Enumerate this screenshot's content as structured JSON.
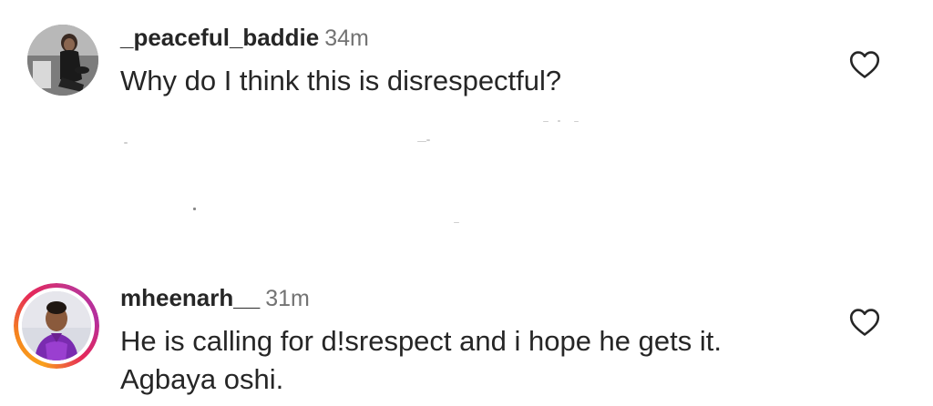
{
  "comments": [
    {
      "username": "_peaceful_baddie",
      "time": "34m",
      "text": "Why do I think this is disrespectful?",
      "like_icon": "heart-outline-icon"
    },
    {
      "username": "mheenarh__",
      "time": "31m",
      "text": "He is calling for d!srespect and i hope he gets it. Agbaya oshi.",
      "like_icon": "heart-outline-icon",
      "story_ring": true
    }
  ],
  "colors": {
    "username": "#262626",
    "time": "#737373",
    "text": "#262626",
    "icon": "#262626",
    "background": "#ffffff"
  }
}
